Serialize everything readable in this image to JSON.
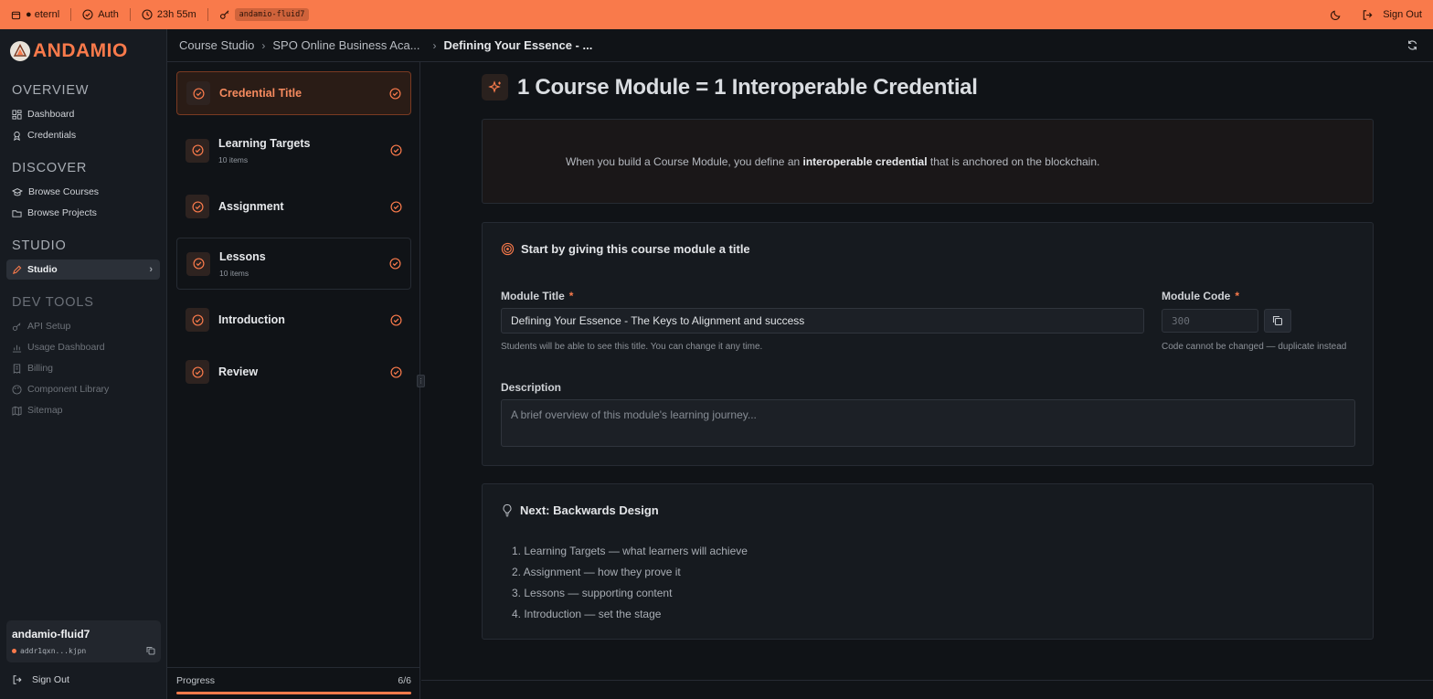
{
  "topbar": {
    "wallet_label": "● eternl",
    "auth_label": "Auth",
    "time_label": "23h 55m",
    "alias_chip": "andamio-fluid7",
    "signout_label": "Sign Out"
  },
  "brand": {
    "name": "ANDAMIO",
    "accent_color": "#f97a4b"
  },
  "sidebar": {
    "sections": [
      {
        "title": "OVERVIEW",
        "items": [
          "Dashboard",
          "Credentials"
        ]
      },
      {
        "title": "DISCOVER",
        "items": [
          "Browse Courses",
          "Browse Projects"
        ]
      },
      {
        "title": "STUDIO",
        "items": [
          "Studio"
        ]
      },
      {
        "title": "DEV TOOLS",
        "items": [
          "API Setup",
          "Usage Dashboard",
          "Billing",
          "Component Library",
          "Sitemap"
        ]
      }
    ],
    "active_item": "Studio",
    "user": {
      "name": "andamio-fluid7",
      "address": "addr1qxn...kjpn"
    },
    "signout_label": "Sign Out"
  },
  "breadcrumb": {
    "items": [
      "Course Studio",
      "SPO Online Business Aca...",
      "Defining Your Essence - ..."
    ]
  },
  "steps": {
    "items": [
      {
        "label": "Credential Title",
        "sub": ""
      },
      {
        "label": "Learning Targets",
        "sub": "10 items"
      },
      {
        "label": "Assignment",
        "sub": ""
      },
      {
        "label": "Lessons",
        "sub": "10 items"
      },
      {
        "label": "Introduction",
        "sub": ""
      },
      {
        "label": "Review",
        "sub": ""
      }
    ],
    "active_index": 0,
    "progress_label": "Progress",
    "progress_text": "6/6",
    "progress_fraction": 1.0
  },
  "main": {
    "title": "1 Course Module = 1 Interoperable Credential",
    "intro_prefix": "When you build a Course Module, you define an ",
    "intro_bold": "interoperable credential",
    "intro_suffix": " that is anchored on the blockchain.",
    "form": {
      "heading": "Start by giving this course module a title",
      "module_title_label": "Module Title",
      "module_title_value": "Defining Your Essence - The Keys to Alignment and success",
      "module_title_hint": "Students will be able to see this title. You can change it any time.",
      "module_code_label": "Module Code",
      "module_code_value": "300",
      "module_code_hint": "Code cannot be changed — duplicate instead",
      "required_mark": "*",
      "description_label": "Description",
      "description_placeholder": "A brief overview of this module's learning journey..."
    },
    "next": {
      "heading": "Next: Backwards Design",
      "items": [
        "1. Learning Targets — what learners will achieve",
        "2. Assignment — how they prove it",
        "3. Lessons — supporting content",
        "4. Introduction — set the stage"
      ]
    }
  }
}
